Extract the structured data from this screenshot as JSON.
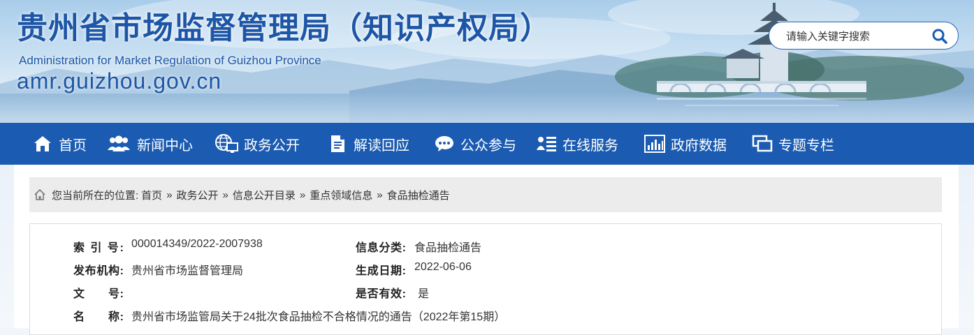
{
  "header": {
    "title": "贵州省市场监督管理局（知识产权局）",
    "subtitle": "Administration for Market Regulation of Guizhou Province",
    "domain": "amr.guizhou.gov.cn",
    "search": {
      "placeholder": "请输入关键字搜索",
      "icon": "search-icon"
    }
  },
  "nav": {
    "items": [
      {
        "label": "首页",
        "icon": "home-icon"
      },
      {
        "label": "新闻中心",
        "icon": "people-icon"
      },
      {
        "label": "政务公开",
        "icon": "globe-monitor-icon"
      },
      {
        "label": "解读回应",
        "icon": "document-icon"
      },
      {
        "label": "公众参与",
        "icon": "chat-icon"
      },
      {
        "label": "在线服务",
        "icon": "user-list-icon"
      },
      {
        "label": "政府数据",
        "icon": "bar-chart-icon"
      },
      {
        "label": "专题专栏",
        "icon": "windows-icon"
      }
    ],
    "background": "#1b5bb1"
  },
  "breadcrumb": {
    "prefix": "您当前所在的位置:",
    "items": [
      "首页",
      "政务公开",
      "信息公开目录",
      "重点领域信息",
      "食品抽检通告"
    ],
    "separator": "»"
  },
  "meta": {
    "index_label": "索 引 号:",
    "index_value": "000014349/2022-2007938",
    "category_label": "信息分类:",
    "category_value": "食品抽检通告",
    "publisher_label": "发布机构:",
    "publisher_value": "贵州省市场监督管理局",
    "date_label": "生成日期:",
    "date_value": "2022-06-06",
    "docno_label": "文　　号:",
    "docno_value": "",
    "valid_label": "是否有效:",
    "valid_value": "是",
    "name_label": "名　　称:",
    "name_value": "贵州省市场监管局关于24批次食品抽检不合格情况的通告（2022年第15期）"
  },
  "colors": {
    "brand_blue": "#1d56a6",
    "nav_blue": "#1b5bb1",
    "breadcrumb_bg": "#ececec"
  }
}
